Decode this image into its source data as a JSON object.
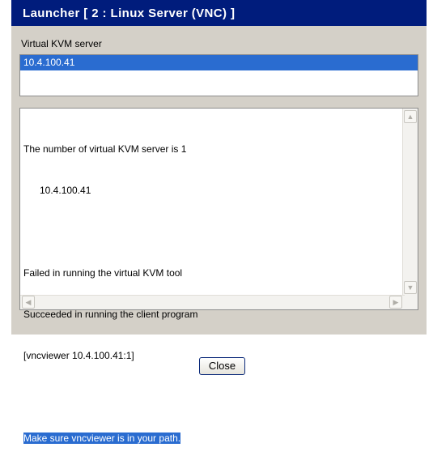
{
  "window": {
    "title": "Launcher [ 2 : Linux Server (VNC) ]"
  },
  "kvm": {
    "label": "Virtual KVM server",
    "servers": [
      "10.4.100.41"
    ],
    "selected": "10.4.100.41"
  },
  "log": {
    "lines": [
      "The number of virtual KVM server is 1",
      "10.4.100.41",
      "",
      "Failed in running the virtual KVM tool",
      "Succeeded in running the client program",
      "[vncviewer 10.4.100.41:1]",
      "",
      "Make sure vncviewer is in your path."
    ]
  },
  "buttons": {
    "close": "Close"
  },
  "colors": {
    "titlebar": "#001c7c",
    "selection": "#2a6cd0",
    "panel": "#d4d0c8"
  }
}
